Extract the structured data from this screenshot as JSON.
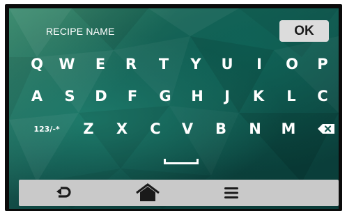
{
  "screen": {
    "title": "RECIPE NAME",
    "ok_label": "OK"
  },
  "keyboard": {
    "row1": [
      "Q",
      "W",
      "E",
      "R",
      "T",
      "Y",
      "U",
      "I",
      "O",
      "P"
    ],
    "row2": [
      "A",
      "S",
      "D",
      "F",
      "G",
      "H",
      "J",
      "K",
      "L",
      "C"
    ],
    "row3_mode_label": "123/-*",
    "row3": [
      "Z",
      "X",
      "C",
      "V",
      "B",
      "N",
      "M"
    ]
  },
  "icons": {
    "backspace": "backspace-icon",
    "space": "space-bar-icon",
    "back": "back-arrow-icon",
    "home": "home-icon",
    "menu": "menu-icon"
  },
  "colors": {
    "background_primary": "#14574f",
    "key_text": "#ffffff",
    "ok_button": "#dcdcdc",
    "navbar": "#c9c9c9",
    "nav_icon": "#1a1a1a"
  }
}
